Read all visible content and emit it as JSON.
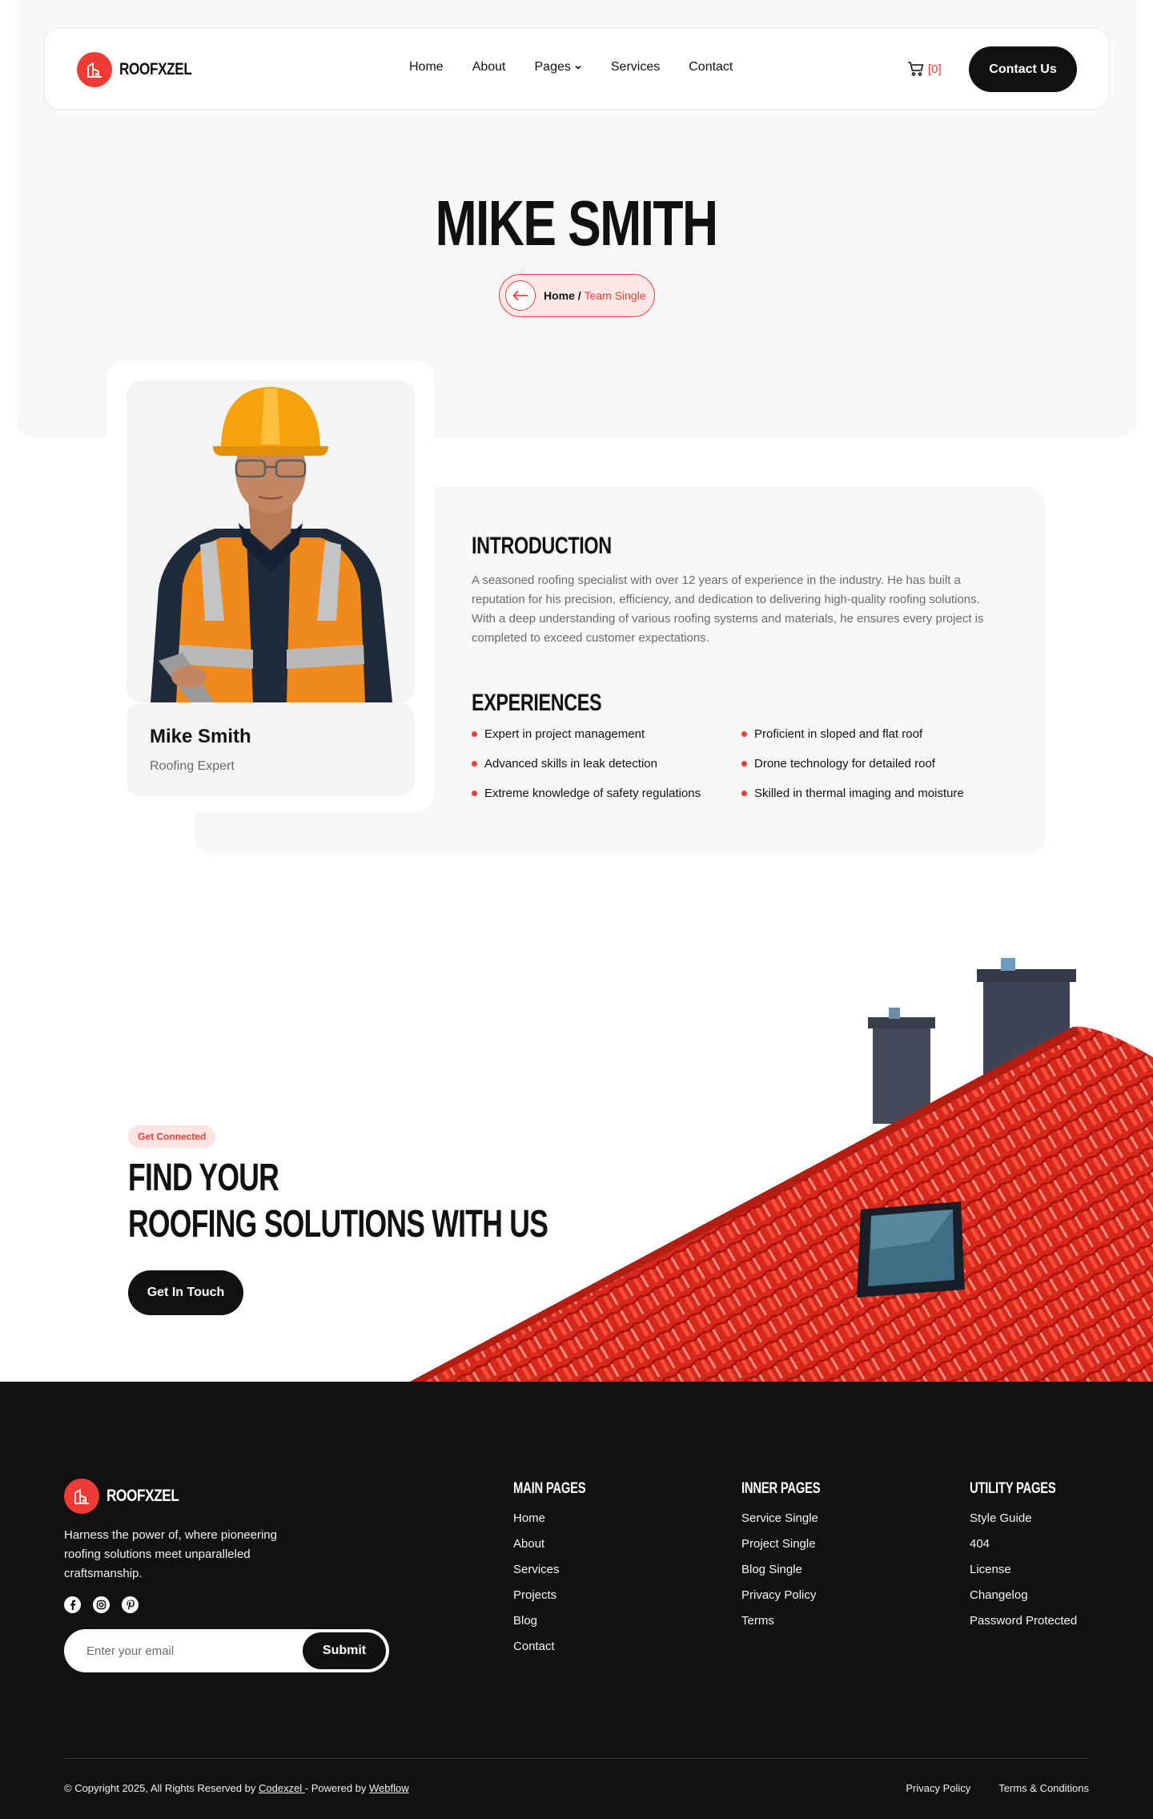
{
  "brand": {
    "name": "ROOFXZEL",
    "accent": "#ef3b36",
    "dark": "#111111"
  },
  "nav": {
    "links": [
      "Home",
      "About",
      "Pages",
      "Services",
      "Contact"
    ],
    "cart_count": "[0]",
    "contact_button": "Contact Us"
  },
  "hero": {
    "title": "MIKE SMITH",
    "breadcrumb": {
      "home": "Home",
      "separator": "/",
      "current": "Team Single"
    }
  },
  "profile": {
    "name": "Mike Smith",
    "role": "Roofing Expert",
    "intro_heading": "INTRODUCTION",
    "intro_text": "A seasoned roofing specialist with over 12 years of experience in the industry. He has built a reputation for his precision, efficiency, and dedication to delivering high-quality roofing solutions. With a deep understanding of various roofing systems and materials, he ensures every project is completed to exceed customer expectations.",
    "experience_heading": "EXPERIENCES",
    "experiences": [
      "Expert in project management",
      "Proficient in sloped and flat roof",
      "Advanced skills in leak detection",
      "Drone technology for detailed roof",
      "Extreme knowledge of safety regulations",
      "Skilled in thermal imaging and moisture"
    ]
  },
  "cta": {
    "tag": "Get Connected",
    "line1": "FIND YOUR",
    "line2": "ROOFING SOLUTIONS WITH US",
    "button": "Get In Touch"
  },
  "footer": {
    "description": "Harness the power of, where pioneering roofing solutions meet unparalleled craftsmanship.",
    "social_icons": [
      "facebook-icon",
      "instagram-icon",
      "pinterest-icon"
    ],
    "email_placeholder": "Enter your email",
    "submit_label": "Submit",
    "columns": [
      {
        "heading": "MAIN PAGES",
        "links": [
          "Home",
          "About",
          "Services",
          "Projects",
          "Blog",
          "Contact"
        ]
      },
      {
        "heading": "INNER PAGES",
        "links": [
          "Service Single",
          "Project Single",
          "Blog Single",
          "Privacy Policy",
          "Terms"
        ]
      },
      {
        "heading": "UTILITY PAGES",
        "links": [
          "Style Guide",
          "404",
          "License",
          "Changelog",
          "Password Protected"
        ]
      }
    ],
    "copyright_prefix": "© Copyright 2025, All Rights Reserved by ",
    "copyright_author": "Codexzel ",
    "copyright_middle": "- Powered by ",
    "copyright_platform": "Webflow",
    "legal_links": [
      "Privacy Policy",
      "Terms & Conditions"
    ]
  }
}
